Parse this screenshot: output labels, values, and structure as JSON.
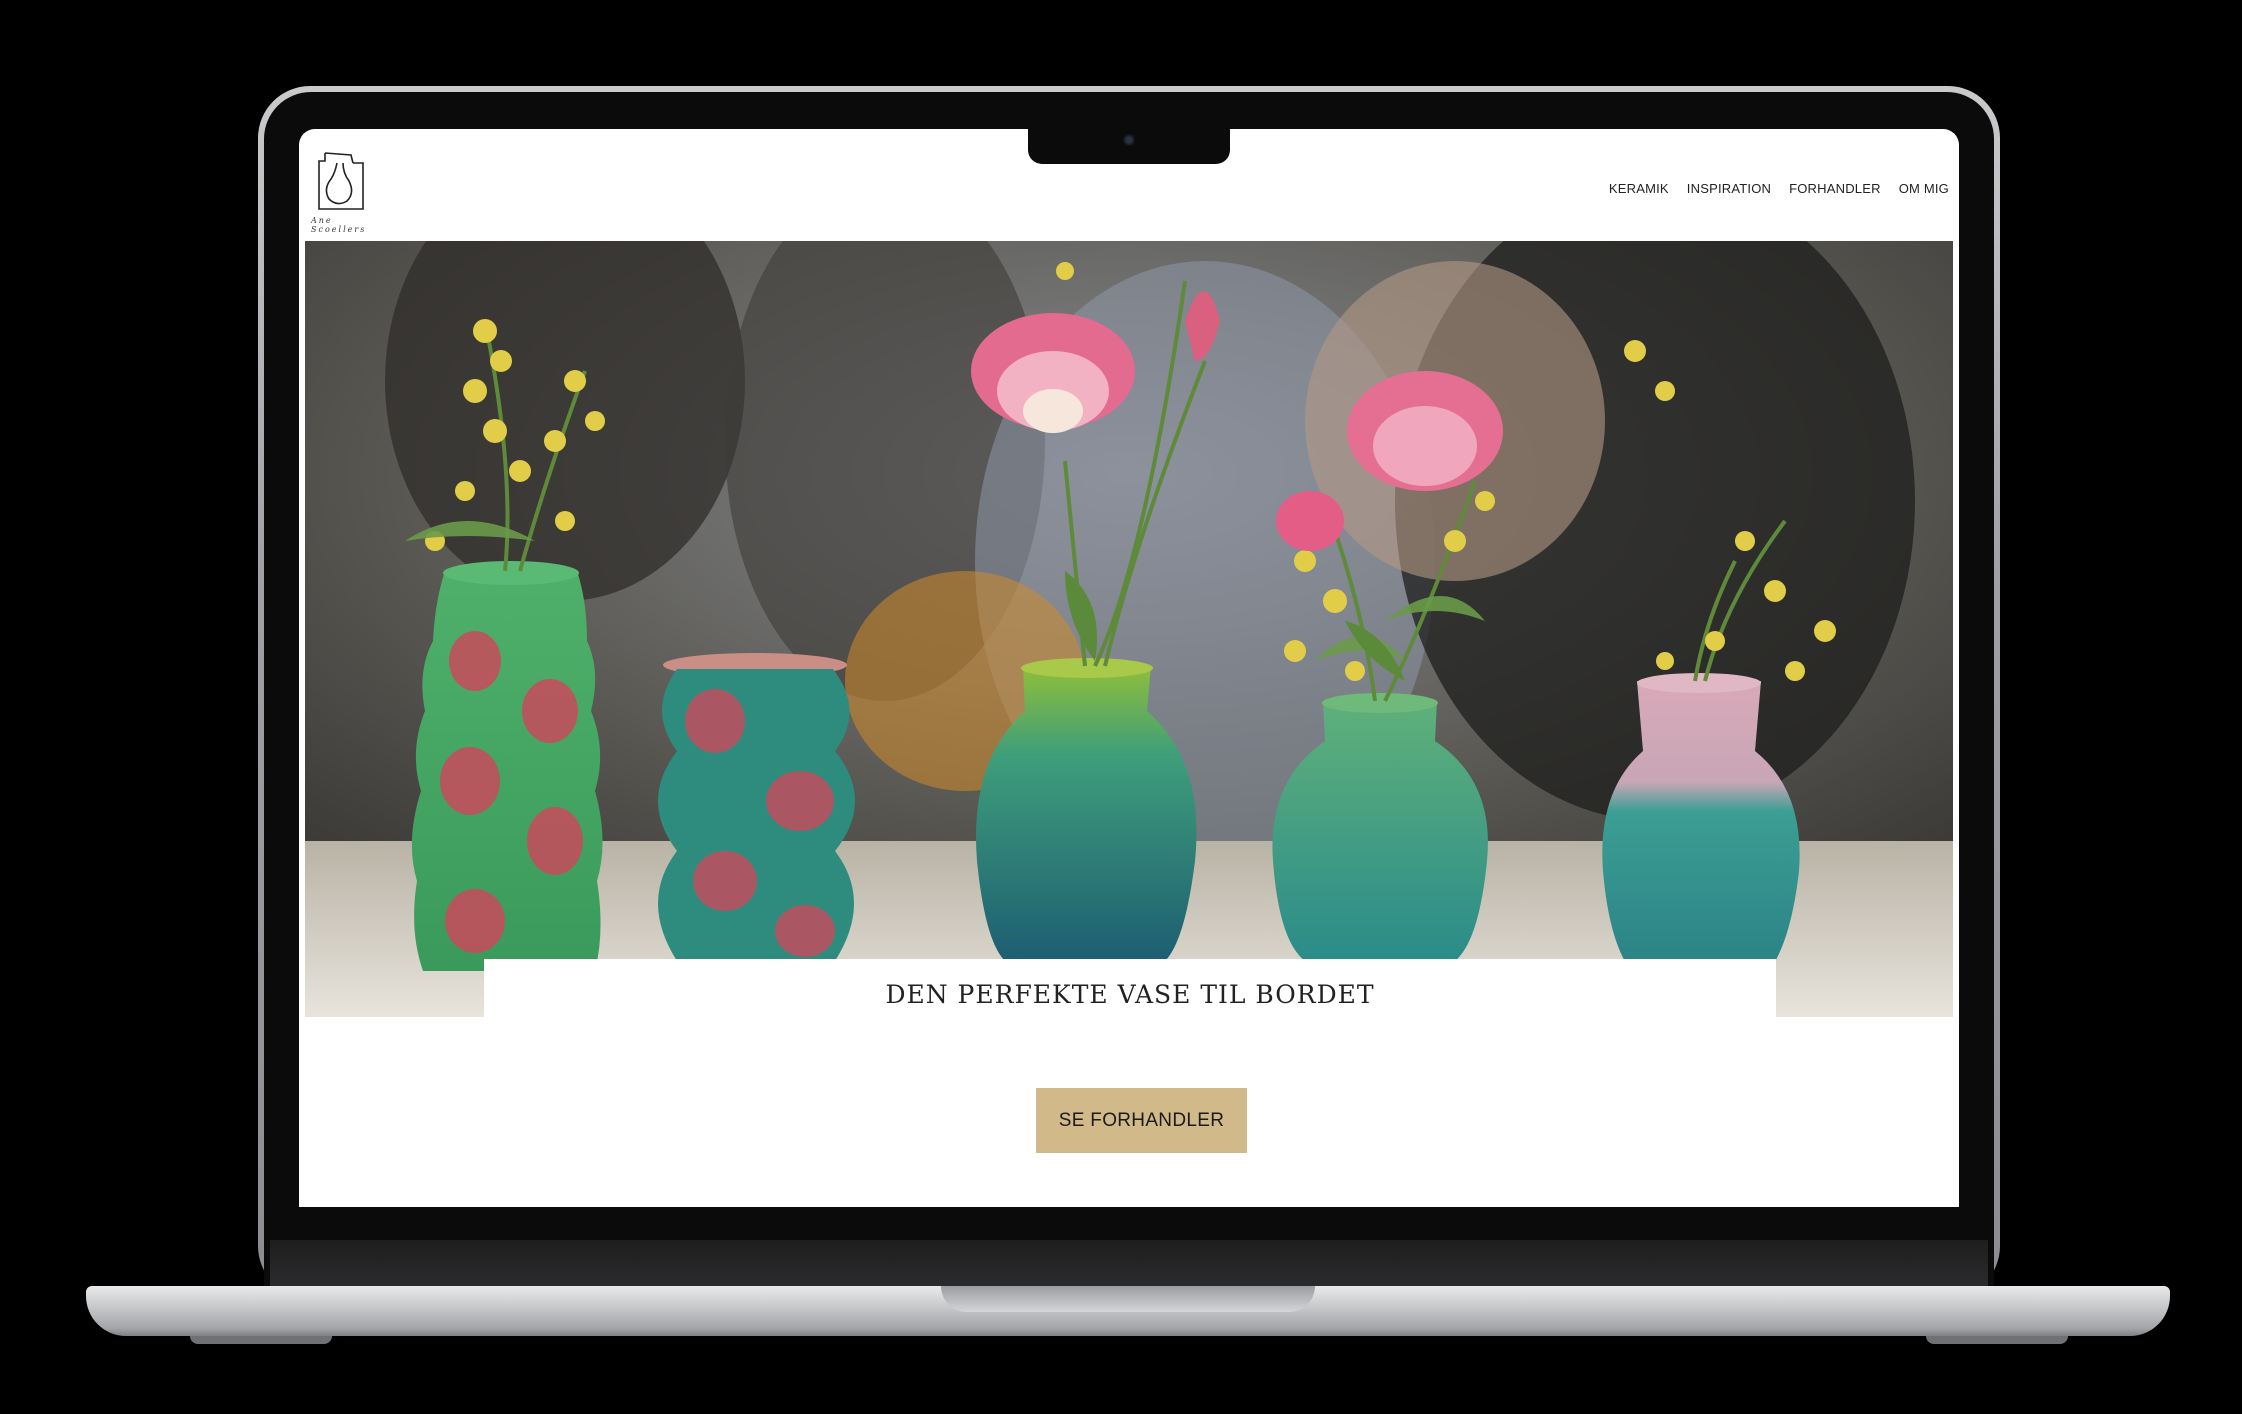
{
  "site": {
    "logo_text": "Ane Scoellers",
    "nav": [
      "KERAMIK",
      "INSPIRATION",
      "FORHANDLER",
      "OM MIG"
    ]
  },
  "hero": {
    "image_alt": "colorful glazed vases with flowers",
    "caption": "DEN PERFEKTE VASE TIL BORDET"
  },
  "cta": {
    "label": "SE FORHANDLER"
  },
  "colors": {
    "button": "#d1b989",
    "vase_teal": "#2e8c82",
    "vase_green": "#4aa35a",
    "vase_red": "#c7485a",
    "flower_pink": "#e56a8e",
    "mimosa_yellow": "#e8d14a"
  }
}
